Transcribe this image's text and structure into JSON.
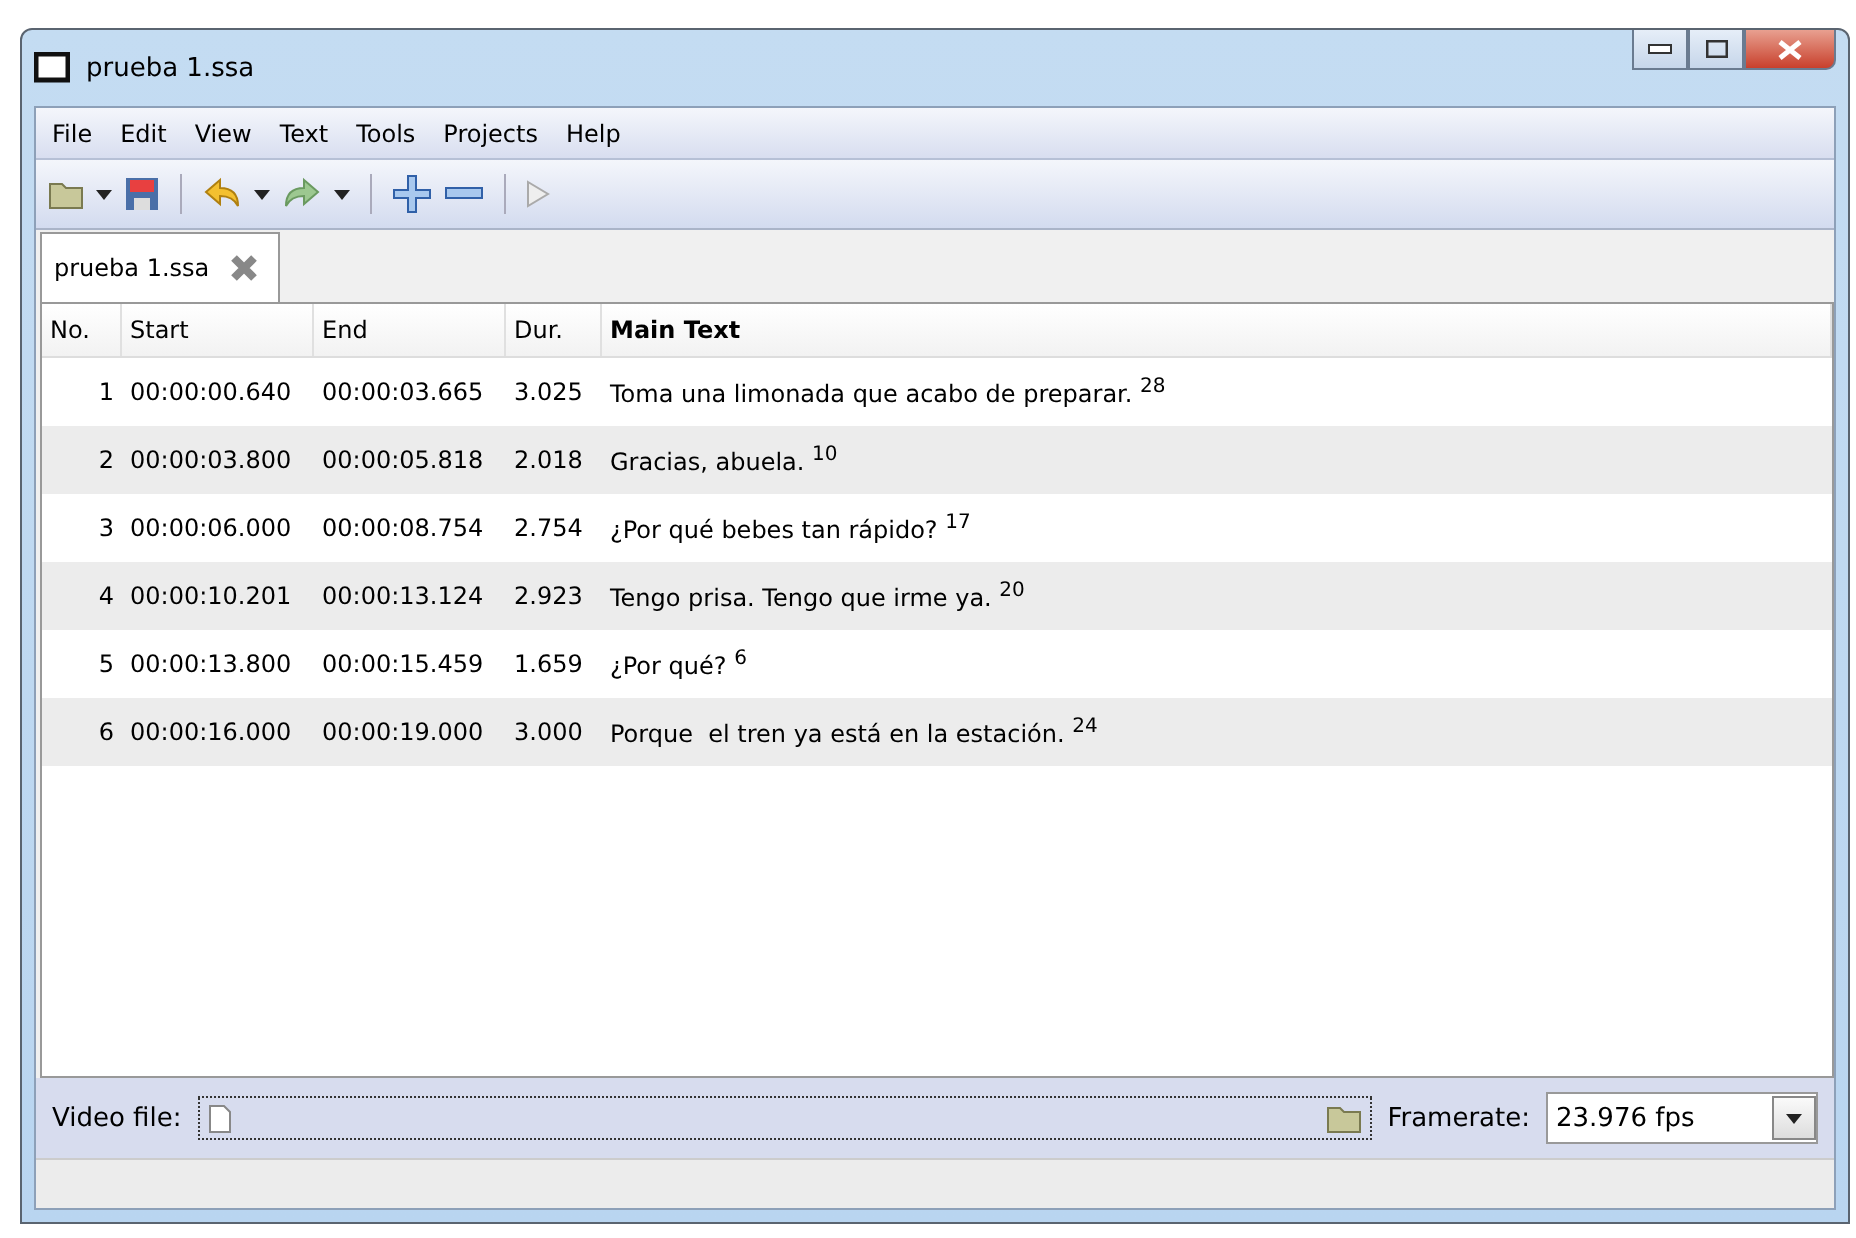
{
  "window": {
    "title": "prueba 1.ssa"
  },
  "menu": [
    "File",
    "Edit",
    "View",
    "Text",
    "Tools",
    "Projects",
    "Help"
  ],
  "tabs": [
    {
      "label": "prueba 1.ssa",
      "selected": true
    }
  ],
  "table": {
    "columns": [
      "No.",
      "Start",
      "End",
      "Dur.",
      "Main Text"
    ],
    "rows": [
      {
        "no": "1",
        "start": "00:00:00.640",
        "end": "00:00:03.665",
        "dur": "3.025",
        "text": "Toma una limonada que acabo de preparar. $^{28}$"
      },
      {
        "no": "2",
        "start": "00:00:03.800",
        "end": "00:00:05.818",
        "dur": "2.018",
        "text": "Gracias, abuela. $^{10}$"
      },
      {
        "no": "3",
        "start": "00:00:06.000",
        "end": "00:00:08.754",
        "dur": "2.754",
        "text": "¿Por qué bebes tan rápido? $^{17}$"
      },
      {
        "no": "4",
        "start": "00:00:10.201",
        "end": "00:00:13.124",
        "dur": "2.923",
        "text": "Tengo prisa. Tengo que irme ya. $^{20}$"
      },
      {
        "no": "5",
        "start": "00:00:13.800",
        "end": "00:00:15.459",
        "dur": "1.659",
        "text": "¿Por qué? $^{6}$"
      },
      {
        "no": "6",
        "start": "00:00:16.000",
        "end": "00:00:19.000",
        "dur": "3.000",
        "text": "Porque  el tren ya está en la estación. $^{24}$"
      }
    ]
  },
  "video": {
    "label": "Video file:",
    "framerate_label": "Framerate:",
    "framerate": "23.976 fps"
  }
}
